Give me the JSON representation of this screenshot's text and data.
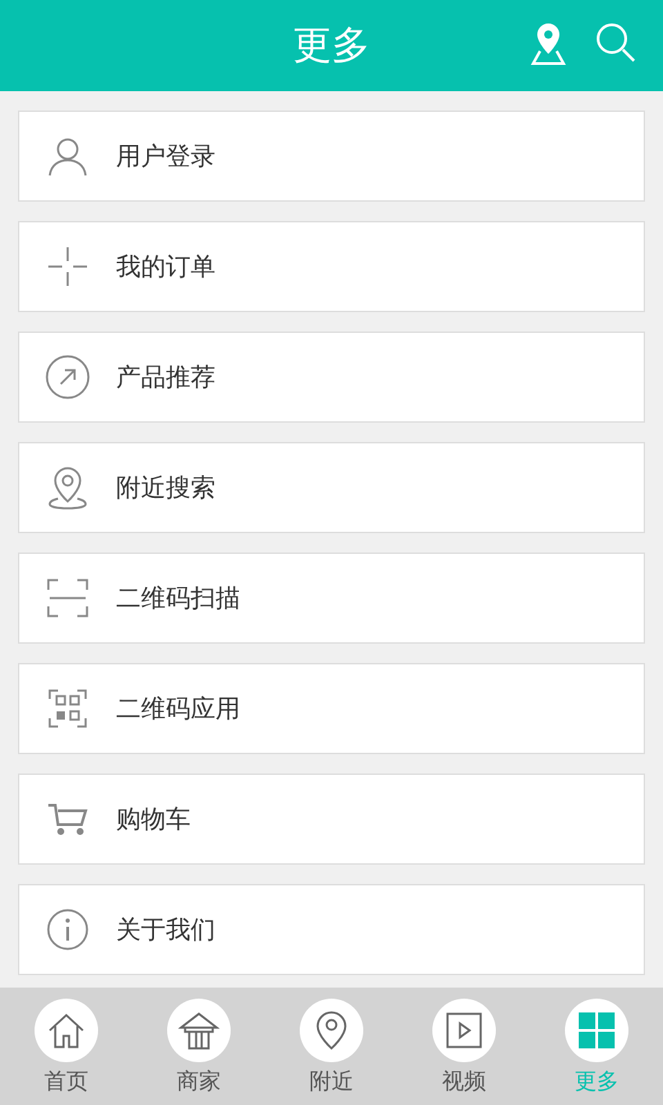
{
  "header": {
    "title": "更多"
  },
  "menu": [
    {
      "label": "用户登录"
    },
    {
      "label": "我的订单"
    },
    {
      "label": "产品推荐"
    },
    {
      "label": "附近搜索"
    },
    {
      "label": "二维码扫描"
    },
    {
      "label": "二维码应用"
    },
    {
      "label": "购物车"
    },
    {
      "label": "关于我们"
    }
  ],
  "tabs": [
    {
      "label": "首页",
      "selected": false
    },
    {
      "label": "商家",
      "selected": false
    },
    {
      "label": "附近",
      "selected": false
    },
    {
      "label": "视频",
      "selected": false
    },
    {
      "label": "更多",
      "selected": true
    }
  ]
}
